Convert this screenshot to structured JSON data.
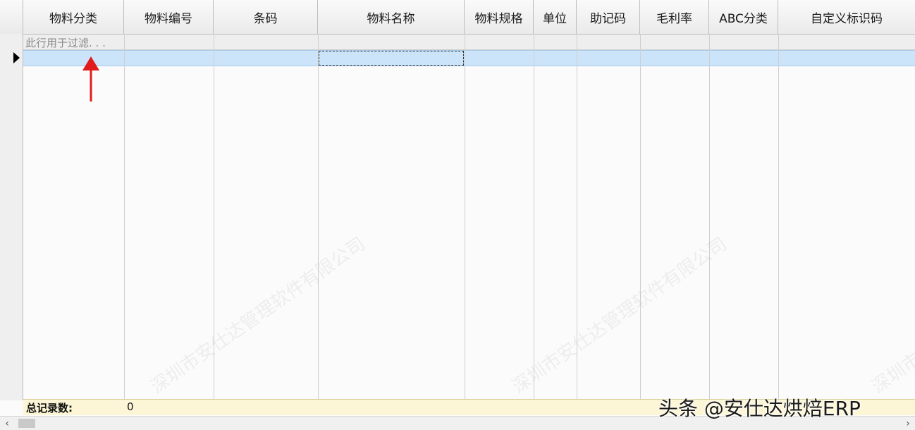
{
  "columns": [
    {
      "label": "物料分类"
    },
    {
      "label": "物料编号"
    },
    {
      "label": "条码"
    },
    {
      "label": "物料名称"
    },
    {
      "label": "物料规格"
    },
    {
      "label": "单位"
    },
    {
      "label": "助记码"
    },
    {
      "label": "毛利率"
    },
    {
      "label": "ABC分类"
    },
    {
      "label": "自定义标识码"
    }
  ],
  "filter_row": {
    "placeholder": "此行用于过滤. . ."
  },
  "footer": {
    "total_label": "总记录数:",
    "total_value": "0"
  },
  "scrollbar": {
    "left_arrow": "‹",
    "right_arrow": "›"
  },
  "watermarks": {
    "w1": "深圳市安仕达管理软件有限公司",
    "w2": "深圳市安仕达管理软件有限公司",
    "w3": "深圳市"
  },
  "brand": "头条 @安仕达烘焙ERP",
  "colors": {
    "selected_row": "#cbe4f9",
    "footer_bg": "#fdf6d6",
    "annotation_arrow": "#e01b1b"
  }
}
